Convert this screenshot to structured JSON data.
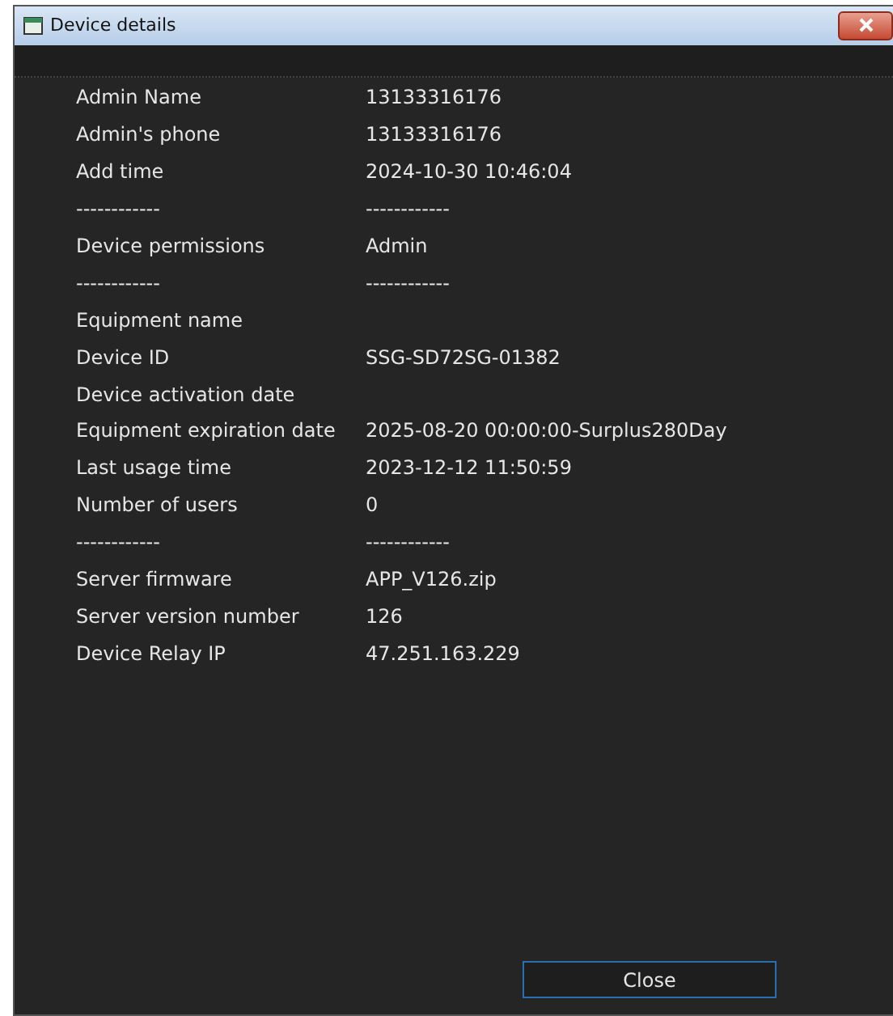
{
  "window": {
    "title": "Device details"
  },
  "rows": [
    {
      "label": "Admin Name",
      "value": "13133316176"
    },
    {
      "label": "Admin's phone",
      "value": "13133316176"
    },
    {
      "label": "Add time",
      "value": "2024-10-30 10:46:04"
    },
    {
      "label": "------------",
      "value": "------------"
    },
    {
      "label": "Device permissions",
      "value": "Admin"
    },
    {
      "label": "------------",
      "value": "------------"
    },
    {
      "label": "Equipment name"
    },
    {
      "label": "Device ID",
      "value": "SSG-SD72SG-01382"
    },
    {
      "label": "Device activation date"
    },
    {
      "label": "Equipment expiration date",
      "value": "2025-08-20 00:00:00-Surplus280Day"
    },
    {
      "label": "Last usage time",
      "value": "2023-12-12 11:50:59"
    },
    {
      "label": "Number of users",
      "value": "0"
    },
    {
      "label": "------------",
      "value": "------------"
    },
    {
      "label": "Server firmware",
      "value": "APP_V126.zip"
    },
    {
      "label": "Server version number",
      "value": "126"
    },
    {
      "label": "Device Relay IP",
      "value": "47.251.163.229"
    }
  ],
  "buttons": [
    "Close"
  ]
}
